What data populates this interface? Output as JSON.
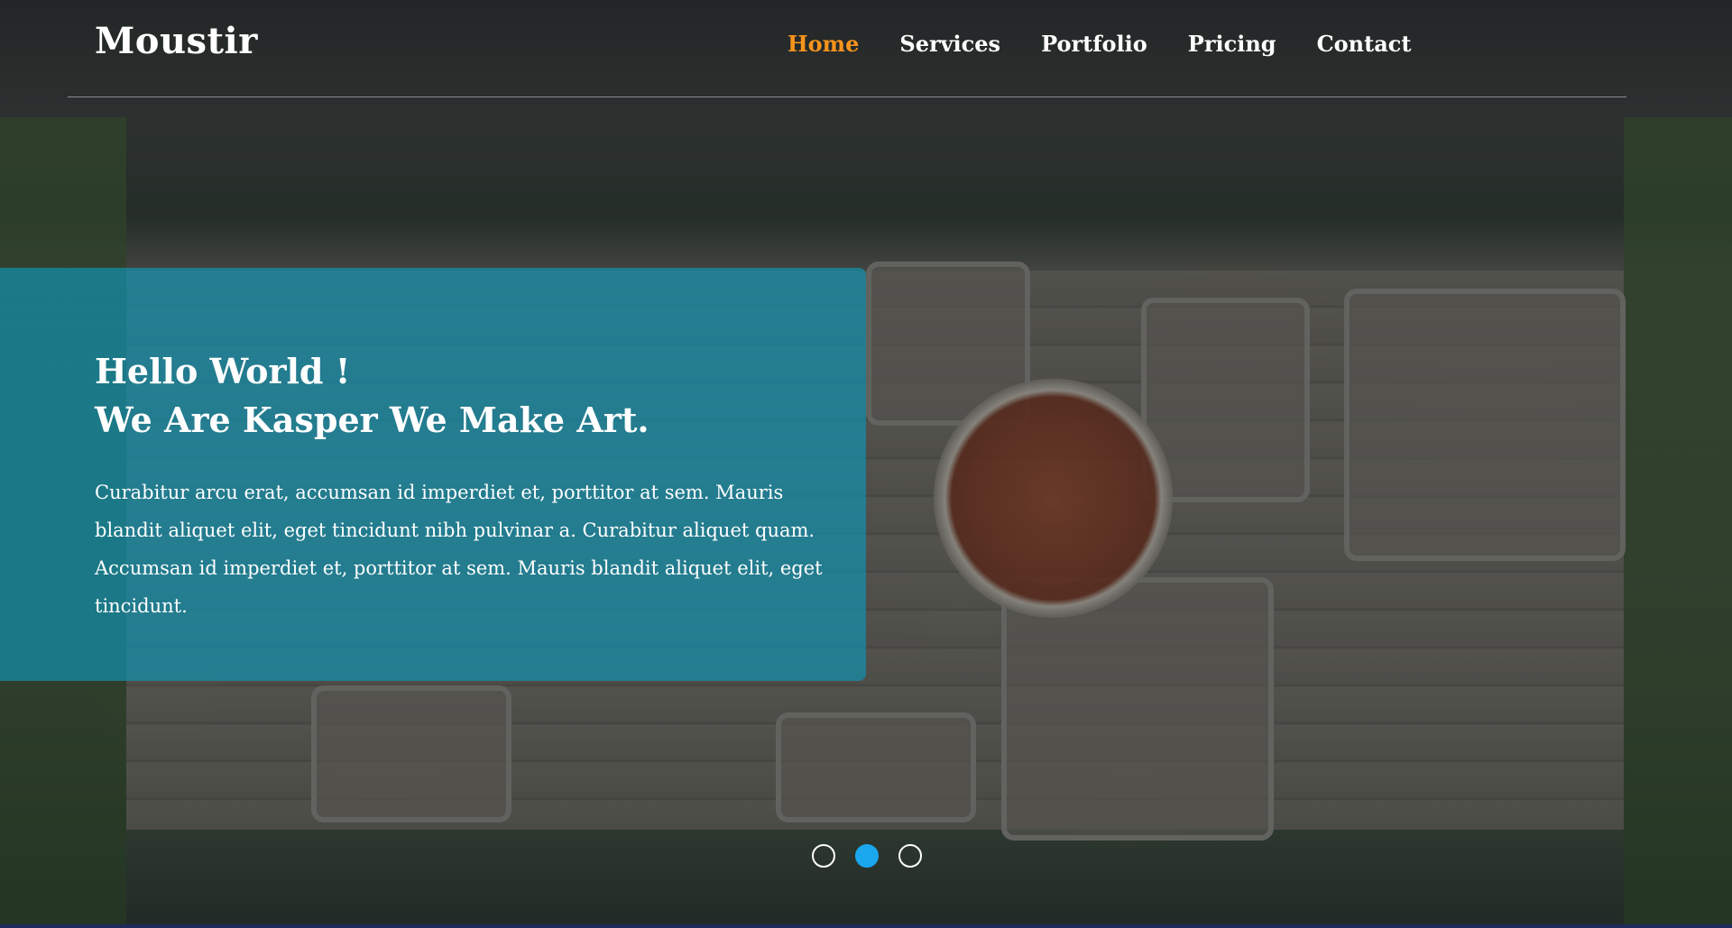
{
  "header": {
    "logo": "Moustir",
    "nav": [
      {
        "label": "Home",
        "active": true
      },
      {
        "label": "Services",
        "active": false
      },
      {
        "label": "Portfolio",
        "active": false
      },
      {
        "label": "Pricing",
        "active": false
      },
      {
        "label": "Contact",
        "active": false
      }
    ]
  },
  "intro": {
    "title_line1": "Hello World !",
    "title_line2": "We Are Kasper We Make Art.",
    "text": "Curabitur arcu erat, accumsan id imperdiet et, porttitor at sem. Mauris blandit aliquet elit, eget tincidunt nibh pulvinar a. Curabitur aliquet quam. Accumsan id imperdiet et, porttitor at sem. Mauris blandit aliquet elit, eget tincidunt."
  },
  "slider": {
    "count": 3,
    "active_index": 1
  },
  "colors": {
    "accent_nav": "#f7941d",
    "intro_box": "#138faa",
    "bullet_active": "#1aa7ee"
  }
}
